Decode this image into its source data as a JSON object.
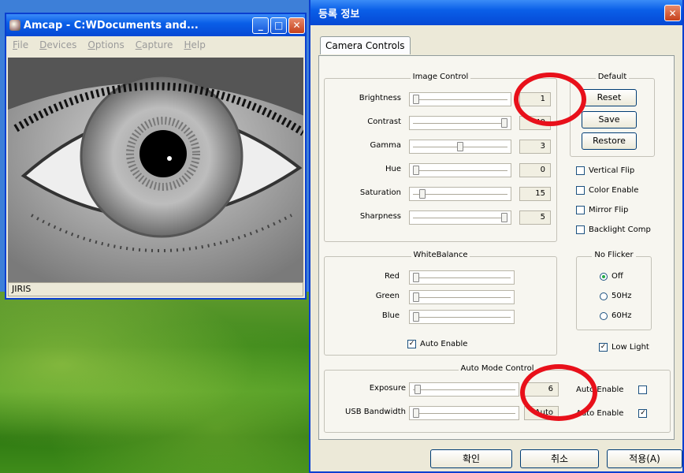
{
  "amcap": {
    "title": "Amcap - C:WDocuments and...",
    "menu": [
      "File",
      "Devices",
      "Options",
      "Capture",
      "Help"
    ],
    "status": "JIRIS"
  },
  "dialog": {
    "title": "등록 정보",
    "tab": "Camera Controls",
    "image_control": {
      "title": "Image Control",
      "rows": [
        {
          "label": "Brightness",
          "value": "1",
          "level": 0.0
        },
        {
          "label": "Contrast",
          "value": "40",
          "level": 1.0
        },
        {
          "label": "Gamma",
          "value": "3",
          "level": 0.5
        },
        {
          "label": "Hue",
          "value": "0",
          "level": 0.0
        },
        {
          "label": "Saturation",
          "value": "15",
          "level": 0.07
        },
        {
          "label": "Sharpness",
          "value": "5",
          "level": 1.0
        }
      ]
    },
    "default": {
      "title": "Default",
      "buttons": [
        "Reset",
        "Save",
        "Restore"
      ]
    },
    "checks": [
      {
        "label": "Vertical Flip",
        "checked": false
      },
      {
        "label": "Color Enable",
        "checked": false
      },
      {
        "label": "Mirror Flip",
        "checked": false
      },
      {
        "label": "Backlight Comp",
        "checked": false
      }
    ],
    "white_balance": {
      "title": "WhiteBalance",
      "rows": [
        {
          "label": "Red"
        },
        {
          "label": "Green"
        },
        {
          "label": "Blue"
        }
      ],
      "auto_label": "Auto Enable",
      "auto_checked": true
    },
    "no_flicker": {
      "title": "No Flicker",
      "options": [
        {
          "label": "Off",
          "selected": true
        },
        {
          "label": "50Hz",
          "selected": false
        },
        {
          "label": "60Hz",
          "selected": false
        }
      ]
    },
    "low_light": {
      "label": "Low Light",
      "checked": true
    },
    "auto_mode": {
      "title": "Auto Mode Control",
      "exposure": {
        "label": "Exposure",
        "value": "6",
        "auto_label": "Auto Enable",
        "auto_checked": false
      },
      "usb": {
        "label": "USB Bandwidth",
        "value": "Auto",
        "auto_label": "Auto Enable",
        "auto_checked": true
      }
    },
    "footer": {
      "ok": "확인",
      "cancel": "취소",
      "apply": "적용(A)"
    },
    "colors": {
      "highlight_circle": "#e8101a",
      "titlebar": "#0a5fe8"
    }
  }
}
